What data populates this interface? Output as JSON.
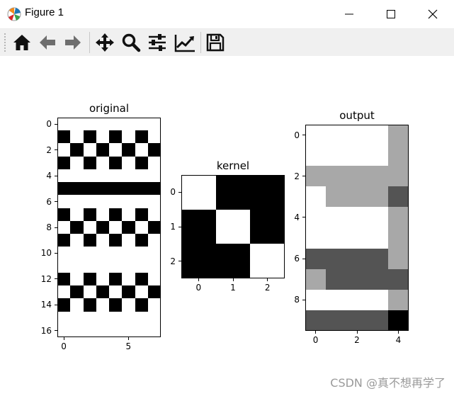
{
  "window": {
    "title": "Figure 1",
    "icon_name": "matplotlib-figure-icon",
    "controls": [
      {
        "name": "minimize-button",
        "icon": "minimize-icon"
      },
      {
        "name": "maximize-button",
        "icon": "maximize-icon"
      },
      {
        "name": "close-button",
        "icon": "close-icon"
      }
    ]
  },
  "toolbar": {
    "buttons": [
      {
        "name": "home-button",
        "icon": "home-icon"
      },
      {
        "name": "back-button",
        "icon": "arrow-left-icon"
      },
      {
        "name": "forward-button",
        "icon": "arrow-right-icon"
      },
      {
        "name": "pan-button",
        "icon": "move-icon"
      },
      {
        "name": "zoom-button",
        "icon": "zoom-icon"
      },
      {
        "name": "configure-subplots-button",
        "icon": "sliders-icon"
      },
      {
        "name": "edit-axes-button",
        "icon": "line-chart-icon"
      },
      {
        "name": "save-button",
        "icon": "save-icon"
      }
    ]
  },
  "colors": {
    "black": "#000000",
    "white": "#ffffff",
    "light_gray": "#a9a9a9",
    "dark_gray": "#555555"
  },
  "chart_data": [
    {
      "type": "heatmap",
      "title": "original",
      "colormap": "gray",
      "rows": 17,
      "cols": 8,
      "values": [
        [
          1,
          1,
          1,
          1,
          1,
          1,
          1,
          1
        ],
        [
          0,
          1,
          0,
          1,
          0,
          1,
          0,
          1
        ],
        [
          1,
          0,
          1,
          0,
          1,
          0,
          1,
          0
        ],
        [
          0,
          1,
          0,
          1,
          0,
          1,
          0,
          1
        ],
        [
          1,
          1,
          1,
          1,
          1,
          1,
          1,
          1
        ],
        [
          0,
          0,
          0,
          0,
          0,
          0,
          0,
          0
        ],
        [
          1,
          1,
          1,
          1,
          1,
          1,
          1,
          1
        ],
        [
          0,
          1,
          0,
          1,
          0,
          1,
          0,
          1
        ],
        [
          1,
          0,
          1,
          0,
          1,
          0,
          1,
          0
        ],
        [
          0,
          1,
          0,
          1,
          0,
          1,
          0,
          1
        ],
        [
          1,
          1,
          1,
          1,
          1,
          1,
          1,
          1
        ],
        [
          1,
          1,
          1,
          1,
          1,
          1,
          1,
          1
        ],
        [
          0,
          1,
          0,
          1,
          0,
          1,
          0,
          1
        ],
        [
          1,
          0,
          1,
          0,
          1,
          0,
          1,
          0
        ],
        [
          0,
          1,
          0,
          1,
          0,
          1,
          0,
          1
        ],
        [
          1,
          1,
          1,
          1,
          1,
          1,
          1,
          1
        ],
        [
          1,
          1,
          1,
          1,
          1,
          1,
          1,
          1
        ]
      ],
      "yticks": [
        "0",
        "2",
        "4",
        "6",
        "8",
        "10",
        "12",
        "14",
        "16"
      ],
      "ytick_values": [
        0,
        2,
        4,
        6,
        8,
        10,
        12,
        14,
        16
      ],
      "xticks": [
        "0",
        "5"
      ],
      "xtick_values": [
        0,
        5
      ]
    },
    {
      "type": "heatmap",
      "title": "kernel",
      "colormap": "gray",
      "rows": 3,
      "cols": 3,
      "values": [
        [
          1,
          0,
          0
        ],
        [
          0,
          1,
          0
        ],
        [
          0,
          0,
          1
        ]
      ],
      "yticks": [
        "0",
        "1",
        "2"
      ],
      "ytick_values": [
        0,
        1,
        2
      ],
      "xticks": [
        "0",
        "1",
        "2"
      ],
      "xtick_values": [
        0,
        1,
        2
      ]
    },
    {
      "type": "heatmap",
      "title": "output",
      "colormap": "gray",
      "rows": 10,
      "cols": 5,
      "values": [
        [
          1,
          1,
          1,
          1,
          0.66
        ],
        [
          1,
          1,
          1,
          1,
          0.66
        ],
        [
          0.66,
          0.66,
          0.66,
          0.66,
          0.66
        ],
        [
          1,
          0.66,
          0.66,
          0.66,
          0.33
        ],
        [
          1,
          1,
          1,
          1,
          0.66
        ],
        [
          1,
          1,
          1,
          1,
          0.66
        ],
        [
          0.33,
          0.33,
          0.33,
          0.33,
          0.66
        ],
        [
          0.66,
          0.33,
          0.33,
          0.33,
          0.33
        ],
        [
          1,
          1,
          1,
          1,
          0.66
        ],
        [
          0.33,
          0.33,
          0.33,
          0.33,
          0
        ]
      ],
      "yticks": [
        "0",
        "2",
        "4",
        "6",
        "8"
      ],
      "ytick_values": [
        0,
        2,
        4,
        6,
        8
      ],
      "xticks": [
        "0",
        "2",
        "4"
      ],
      "xtick_values": [
        0,
        2,
        4
      ]
    }
  ],
  "watermark": "CSDN @真不想再学了"
}
